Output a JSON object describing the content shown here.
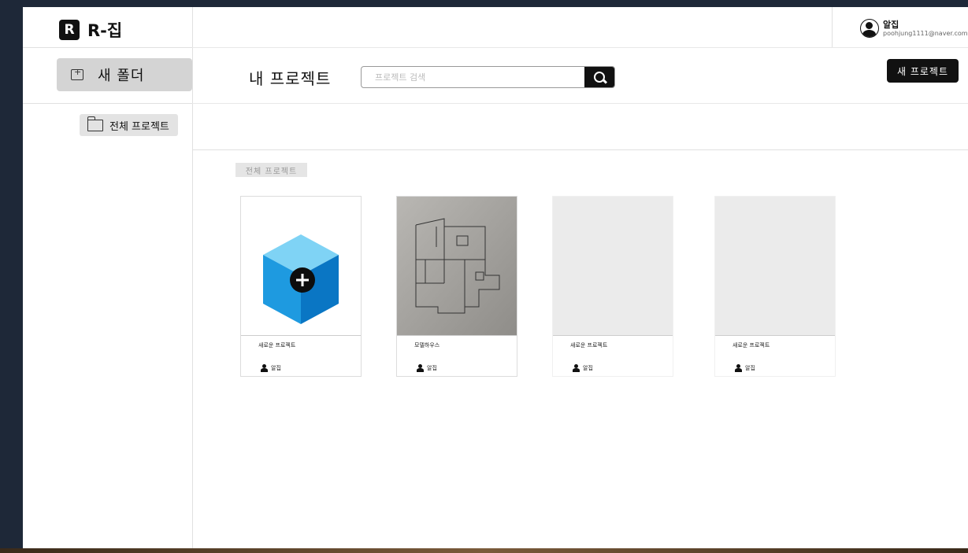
{
  "app": {
    "logo_letter": "R",
    "title": "R-집"
  },
  "user": {
    "name": "알집",
    "email": "poohjung1111@naver.com"
  },
  "sidebar": {
    "new_folder_label": "새 폴더",
    "all_projects_label": "전체 프로젝트"
  },
  "header": {
    "page_title": "내 프로젝트",
    "search_placeholder": "프로젝트 검색",
    "new_project_label": "새 프로젝트"
  },
  "breadcrumb": {
    "label": "전체 프로젝트"
  },
  "projects": [
    {
      "title": "새로운 프로젝트",
      "owner": "알집",
      "thumbnail": "new-project-cube-icon"
    },
    {
      "title": "모델하우스",
      "owner": "알집",
      "thumbnail": "floor-plan-photo"
    },
    {
      "title": "새로운 프로젝트",
      "owner": "알집",
      "thumbnail": "empty"
    },
    {
      "title": "새로운 프로젝트",
      "owner": "알집",
      "thumbnail": "empty"
    }
  ],
  "colors": {
    "accent": "#111111",
    "cube_top": "#7fd3f5",
    "cube_left": "#1e9ae0",
    "cube_right": "#0a76c4"
  }
}
